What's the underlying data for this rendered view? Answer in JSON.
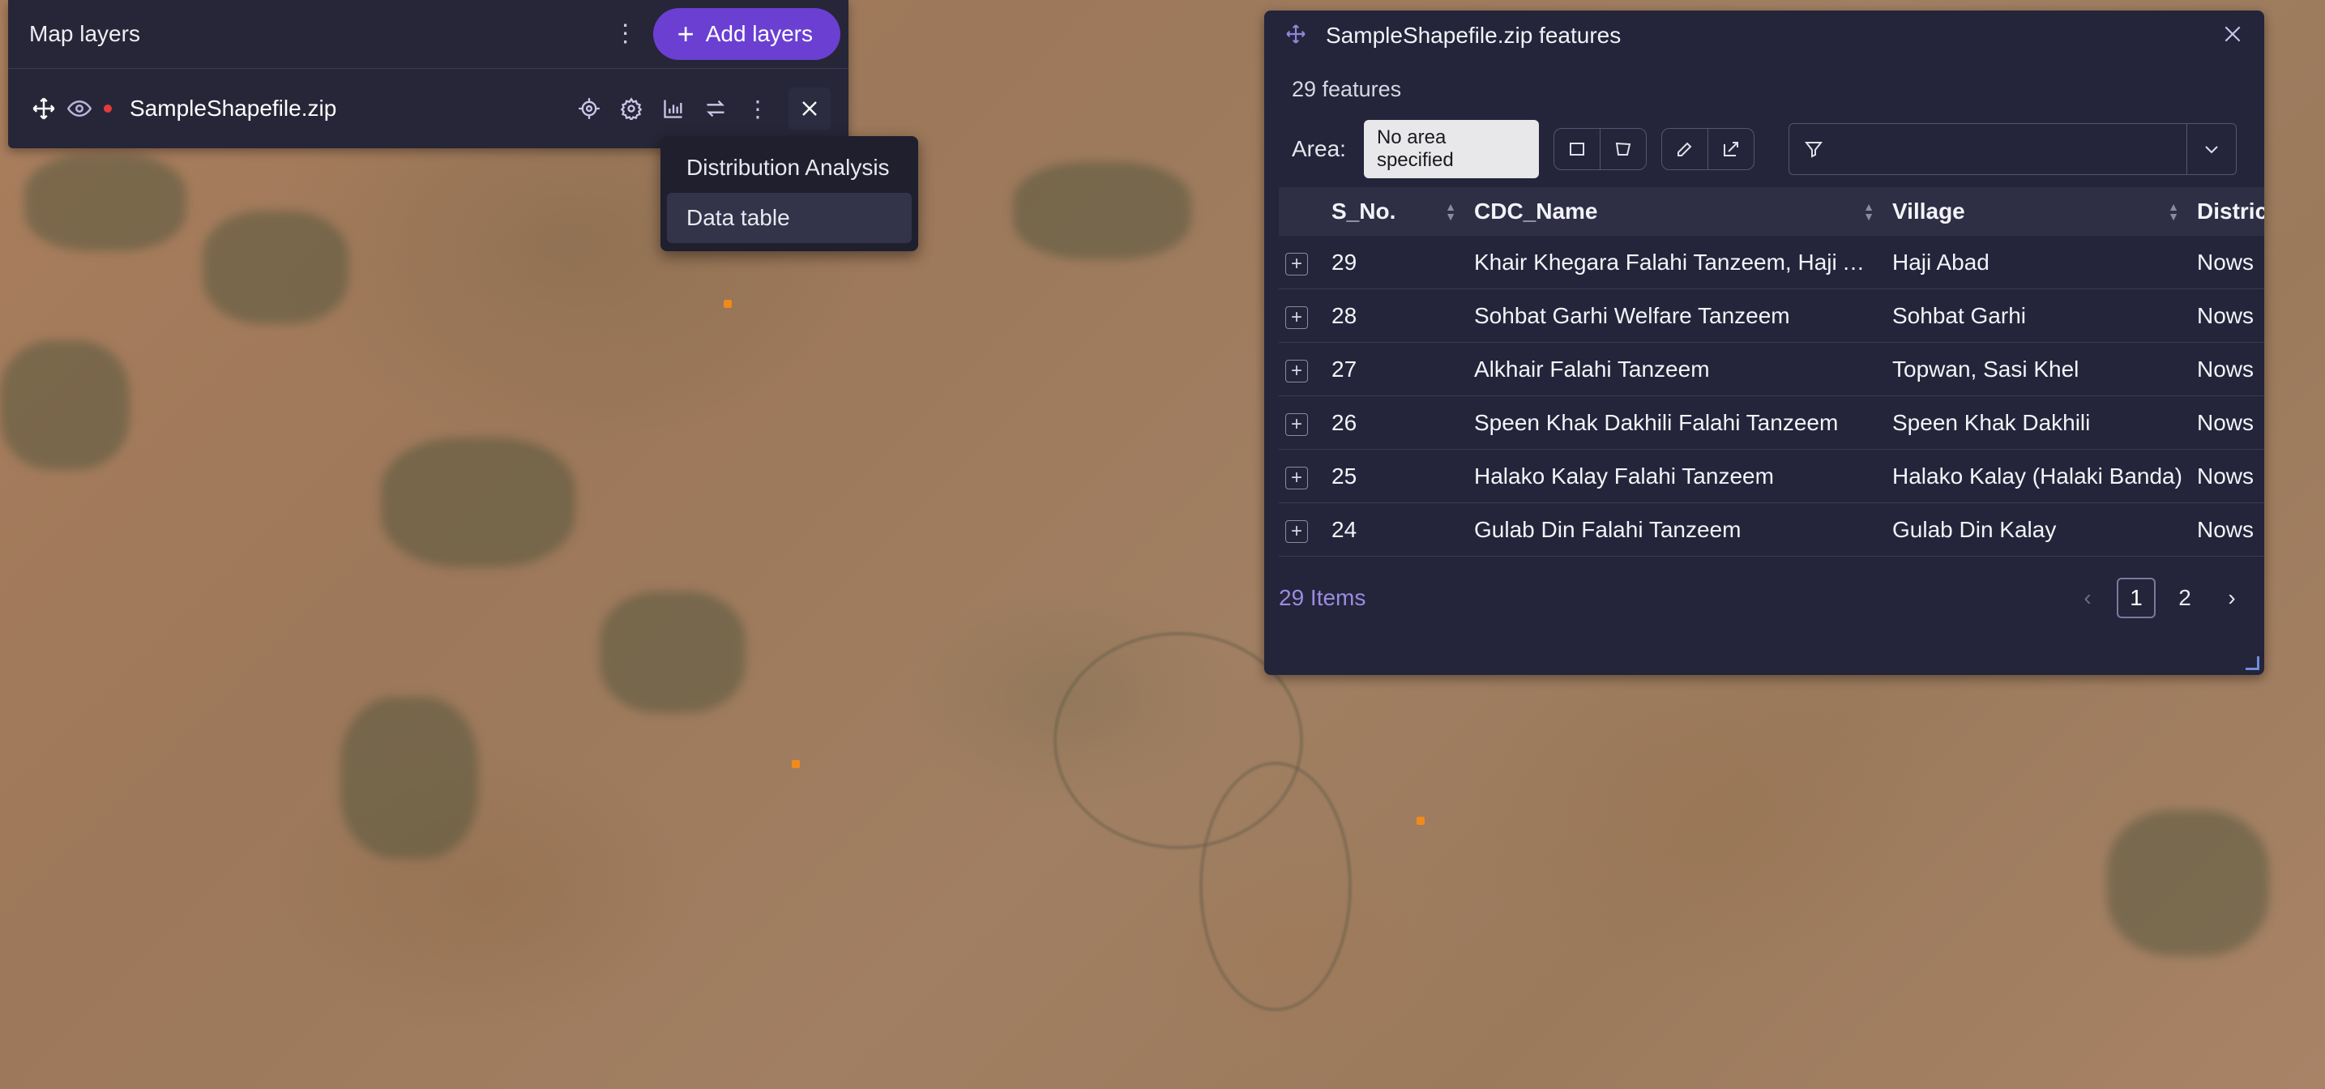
{
  "map": {
    "background": "#a07c5e",
    "marker_color": "#f08a1c"
  },
  "layers_panel": {
    "title": "Map layers",
    "add_button_label": "Add layers",
    "accent": "#6b3fd2",
    "layer": {
      "name": "SampleShapefile.zip",
      "status_color": "#e23b3b"
    },
    "row_icons": [
      "move-icon",
      "eye-icon",
      "locate-icon",
      "gear-icon",
      "chart-icon",
      "swap-icon",
      "more-icon",
      "close-icon"
    ]
  },
  "context_menu": {
    "items": [
      "Distribution Analysis",
      "Data table"
    ],
    "active": "Data table"
  },
  "features_panel": {
    "title": "SampleShapefile.zip features",
    "count_text": "29 features",
    "area_label": "Area:",
    "area_chip": "No area specified",
    "filter_placeholder": "",
    "columns": [
      "S_No.",
      "CDC_Name",
      "Village",
      "Distric"
    ],
    "rows": [
      {
        "s_no": "29",
        "cdc_name": "Khair Khegara Falahi Tanzeem, Haji Ab...",
        "village": "Haji Abad",
        "district": "Nows"
      },
      {
        "s_no": "28",
        "cdc_name": "Sohbat Garhi Welfare Tanzeem",
        "village": "Sohbat Garhi",
        "district": "Nows"
      },
      {
        "s_no": "27",
        "cdc_name": "Alkhair Falahi Tanzeem",
        "village": "Topwan, Sasi Khel",
        "district": "Nows"
      },
      {
        "s_no": "26",
        "cdc_name": "Speen Khak Dakhili Falahi Tanzeem",
        "village": "Speen Khak Dakhili",
        "district": "Nows"
      },
      {
        "s_no": "25",
        "cdc_name": "Halako Kalay Falahi Tanzeem",
        "village": "Halako Kalay (Halaki Banda)",
        "district": "Nows"
      },
      {
        "s_no": "24",
        "cdc_name": "Gulab Din Falahi Tanzeem",
        "village": "Gulab Din Kalay",
        "district": "Nows"
      }
    ],
    "items_text": "29 Items",
    "pages": [
      "1",
      "2"
    ],
    "current_page": "1"
  }
}
